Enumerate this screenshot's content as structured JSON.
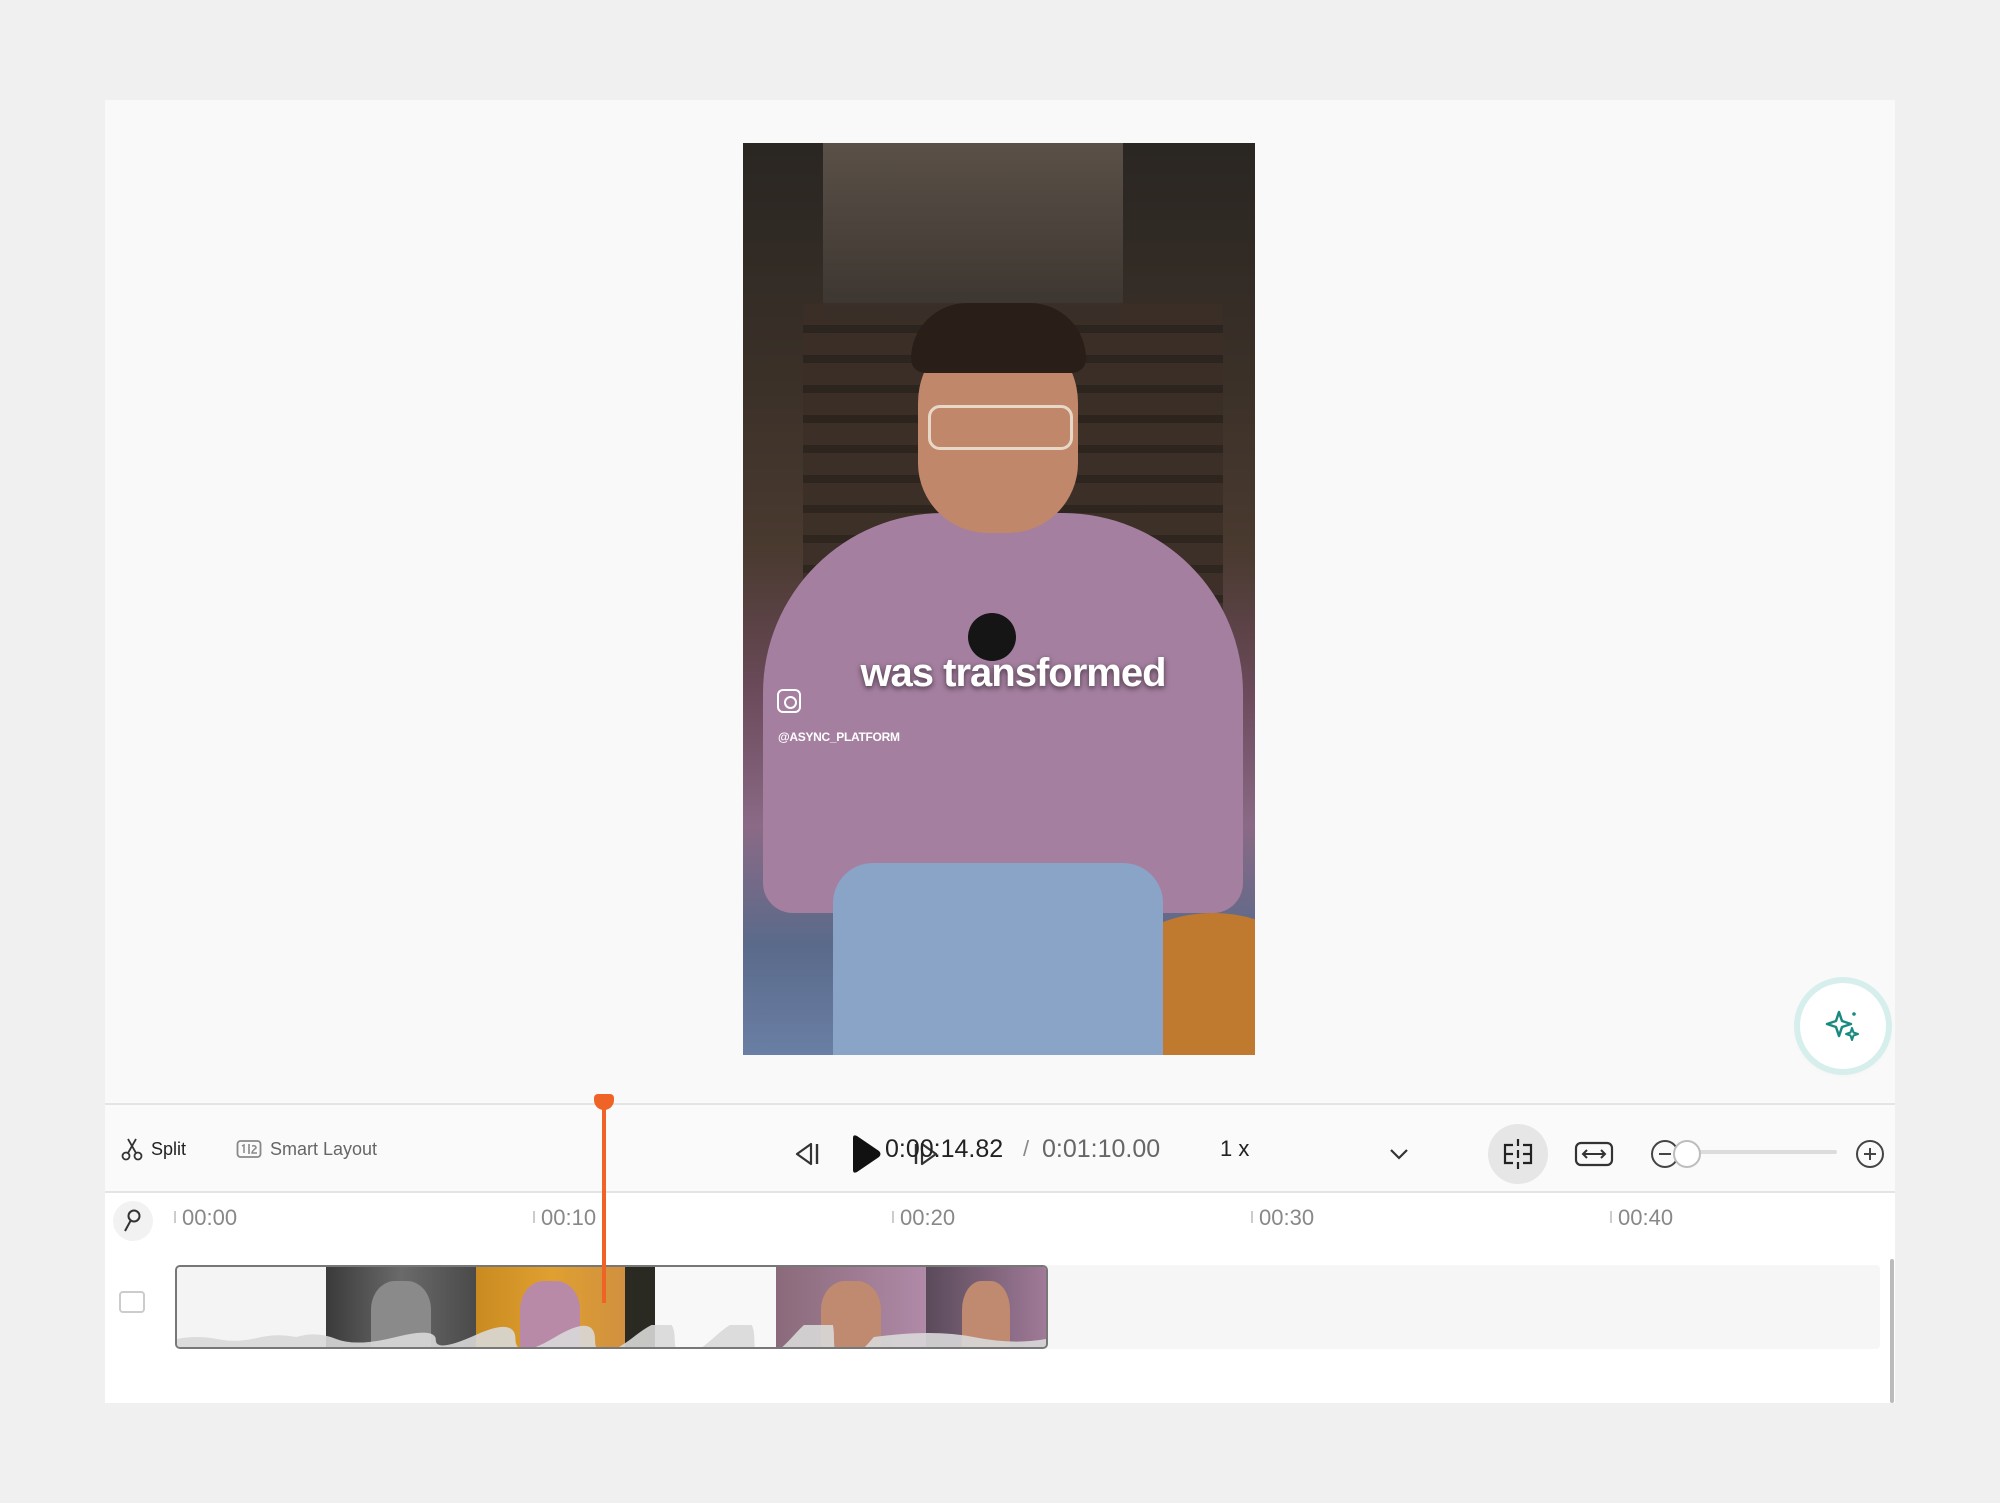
{
  "preview": {
    "caption": "was transformed",
    "handle": "@ASYNC_PLATFORM"
  },
  "toolbar": {
    "split_label": "Split",
    "smart_layout_label": "Smart Layout",
    "current_time": "0:00:14.82",
    "separator": "/",
    "total_time": "0:01:10.00",
    "speed": "1 x"
  },
  "timeline": {
    "ruler": [
      "00:00",
      "00:10",
      "00:20",
      "00:30",
      "00:40"
    ],
    "playhead_time": "0:00:14.82"
  },
  "colors": {
    "accent": "#f06326",
    "ai_teal": "#1a8a80",
    "background": "#f0f0f0"
  },
  "icons": [
    "scissors-icon",
    "smart-layout-icon",
    "skip-back-icon",
    "play-icon",
    "skip-forward-icon",
    "chevron-down-icon",
    "snap-icon",
    "fit-icon",
    "zoom-out-icon",
    "zoom-in-icon",
    "pin-icon",
    "video-track-icon",
    "sparkle-icon",
    "instagram-icon"
  ]
}
